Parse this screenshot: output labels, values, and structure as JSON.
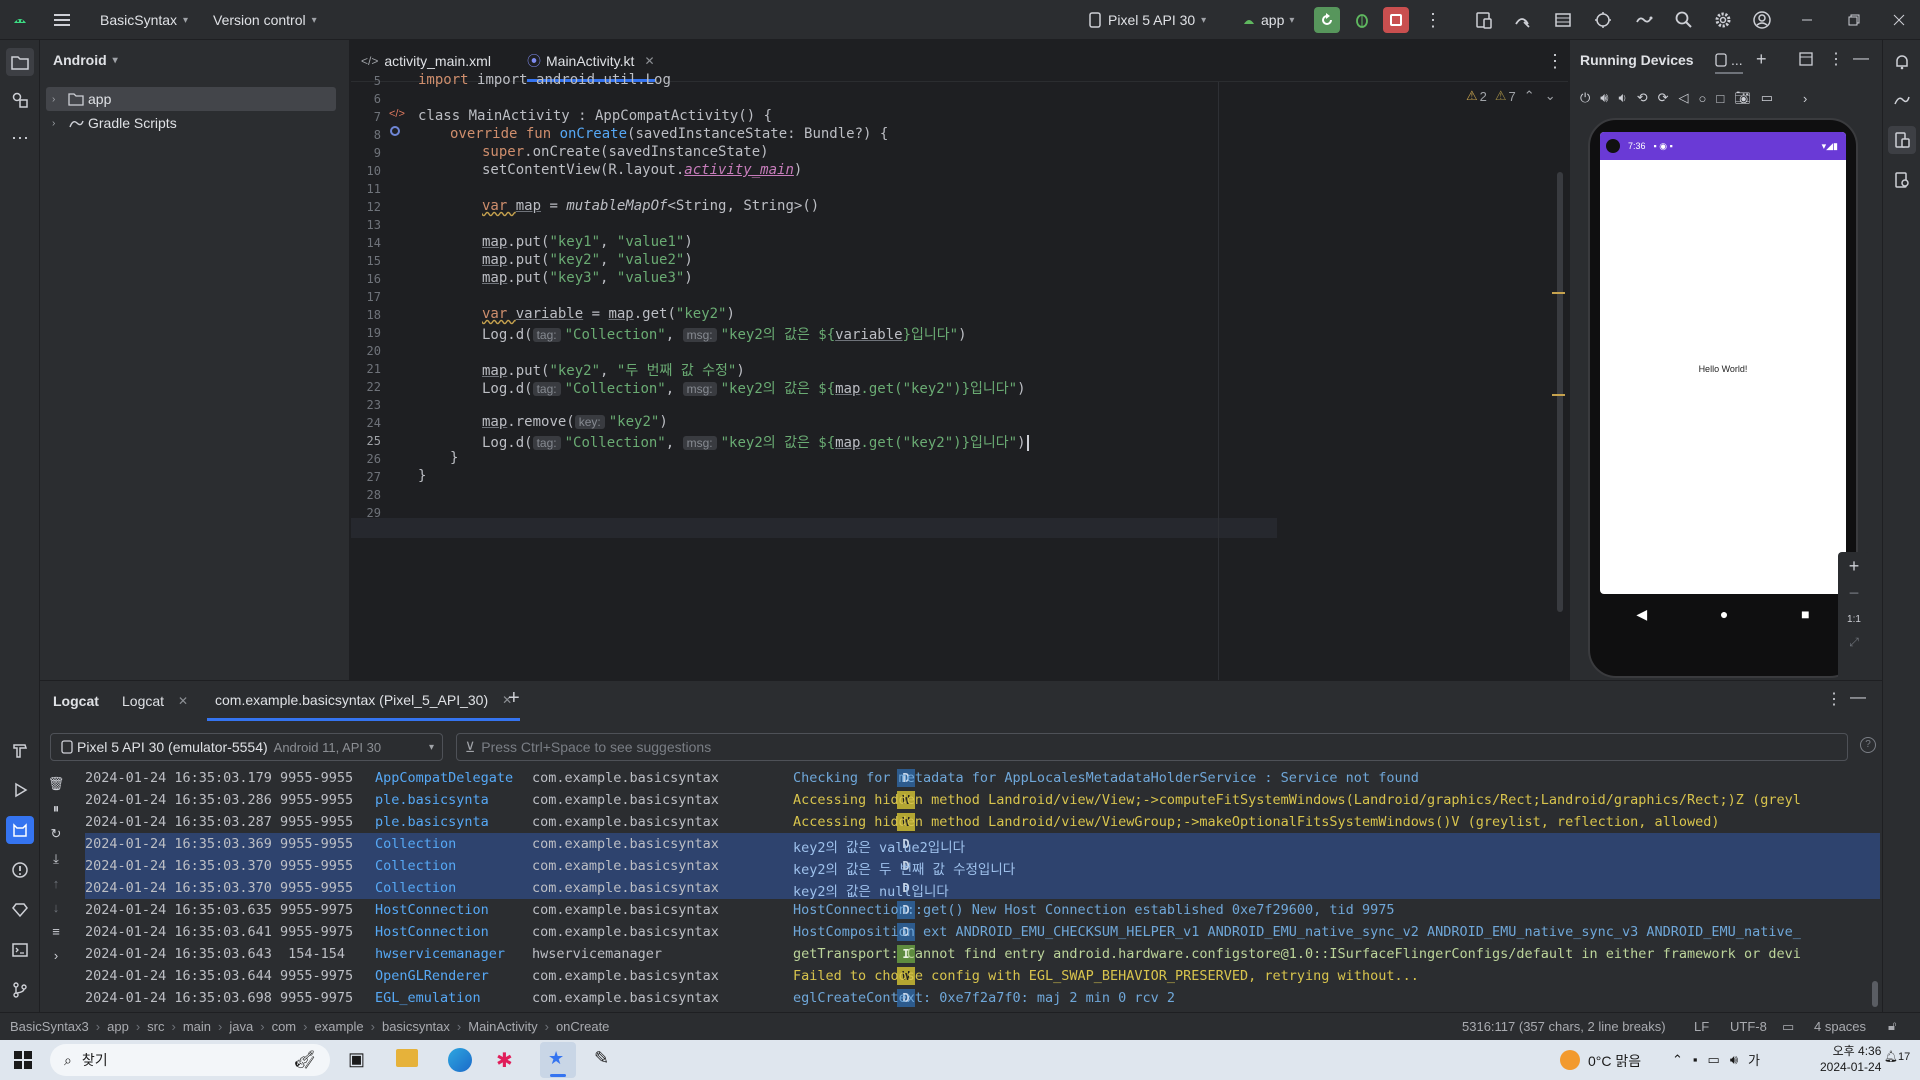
{
  "titlebar": {
    "project_name": "BasicSyntax",
    "vcs_label": "Version control",
    "device_selector": "Pixel 5 API 30",
    "run_config": "app"
  },
  "project_pane": {
    "view_name": "Android",
    "items": [
      {
        "label": "app"
      },
      {
        "label": "Gradle Scripts"
      }
    ]
  },
  "editor": {
    "tabs": [
      {
        "label": "activity_main.xml"
      },
      {
        "label": "MainActivity.kt"
      }
    ],
    "warnings_count": "2",
    "weak_warnings_count": "7",
    "line_numbers": [
      "5",
      "6",
      "7",
      "8",
      "9",
      "10",
      "11",
      "12",
      "13",
      "14",
      "15",
      "16",
      "17",
      "18",
      "19",
      "20",
      "21",
      "22",
      "23",
      "24",
      "25",
      "26",
      "27",
      "28",
      "29"
    ],
    "code": {
      "l5": "import android.util.Log",
      "l7_a": "class MainActivity : AppCompatActivity() {",
      "l8_a": "override fun ",
      "l8_b": "onCreate",
      "l8_c": "(savedInstanceState: Bundle?) {",
      "l9_a": "super",
      "l9_b": ".onCreate(savedInstanceState)",
      "l10_a": "setContentView(R.layout.",
      "l10_b": "activity_main",
      "l10_c": ")",
      "l12_a": "var ",
      "l12_b": "map",
      "l12_c": " = ",
      "l12_d": "mutableMapOf",
      "l12_e": "<String, String>()",
      "l14": [
        "map",
        ".put(",
        "\"key1\"",
        ", ",
        "\"value1\"",
        ")"
      ],
      "l15": [
        "map",
        ".put(",
        "\"key2\"",
        ", ",
        "\"value2\"",
        ")"
      ],
      "l16": [
        "map",
        ".put(",
        "\"key3\"",
        ", ",
        "\"value3\"",
        ")"
      ],
      "l18_a": "var ",
      "l18_b": "variable",
      "l18_c": " = ",
      "l18_d": "map",
      "l18_e": ".get(",
      "l18_f": "\"key2\"",
      "l18_g": ")",
      "hint_tag": "tag:",
      "hint_msg": "msg:",
      "hint_key": "key:",
      "log_d": "Log.d(",
      "collection": "\"Collection\"",
      "comma": ", ",
      "l19_msg_a": "\"key2의 값은 ${",
      "l19_msg_b": "variable",
      "l19_msg_c": "}입니다\"",
      "close": ")",
      "l21": [
        "map",
        ".put(",
        "\"key2\"",
        ", ",
        "\"두 번째 값 수정\"",
        ")"
      ],
      "l22_msg_a": "\"key2의 값은 ${",
      "l22_msg_b": "map",
      "l22_msg_c": ".get(\"key2\")}입니다\"",
      "l24_a": "map",
      "l24_b": ".remove(",
      "l24_c": "\"key2\"",
      "l24_d": ")",
      "l26": "}",
      "l27": "}"
    }
  },
  "devices": {
    "title": "Running Devices",
    "tab_label": "...",
    "phone_time": "7:36",
    "hello_text": "Hello World!",
    "zoom_label": "1:1"
  },
  "logcat": {
    "tabs": [
      {
        "label": "Logcat"
      },
      {
        "label": "Logcat"
      },
      {
        "label": "com.example.basicsyntax (Pixel_5_API_30)"
      }
    ],
    "device_dropdown": "Pixel 5 API 30 (emulator-5554)",
    "device_dropdown_sub": "Android 11, API 30",
    "filter_placeholder": "Press Ctrl+Space to see suggestions",
    "rows": [
      {
        "time": "2024-01-24 16:35:03.179",
        "pid": "9955-9955",
        "tag": "AppCompatDelegate",
        "pkg": "com.example.basicsyntax",
        "level": "D",
        "msg": "Checking for metadata for AppLocalesMetadataHolderService : Service not found",
        "selected": false
      },
      {
        "time": "2024-01-24 16:35:03.286",
        "pid": "9955-9955",
        "tag": "ple.basicsynta",
        "pkg": "com.example.basicsyntax",
        "level": "W",
        "msg": "Accessing hidden method Landroid/view/View;->computeFitSystemWindows(Landroid/graphics/Rect;Landroid/graphics/Rect;)Z (greyl",
        "selected": false
      },
      {
        "time": "2024-01-24 16:35:03.287",
        "pid": "9955-9955",
        "tag": "ple.basicsynta",
        "pkg": "com.example.basicsyntax",
        "level": "W",
        "msg": "Accessing hidden method Landroid/view/ViewGroup;->makeOptionalFitsSystemWindows()V (greylist, reflection, allowed)",
        "selected": false
      },
      {
        "time": "2024-01-24 16:35:03.369",
        "pid": "9955-9955",
        "tag": "Collection",
        "pkg": "com.example.basicsyntax",
        "level": "D",
        "msg": "key2의 값은 value2입니다",
        "selected": true
      },
      {
        "time": "2024-01-24 16:35:03.370",
        "pid": "9955-9955",
        "tag": "Collection",
        "pkg": "com.example.basicsyntax",
        "level": "D",
        "msg": "key2의 값은 두 번째 값 수정입니다",
        "selected": true
      },
      {
        "time": "2024-01-24 16:35:03.370",
        "pid": "9955-9955",
        "tag": "Collection",
        "pkg": "com.example.basicsyntax",
        "level": "D",
        "msg": "key2의 값은 null입니다",
        "selected": true
      },
      {
        "time": "2024-01-24 16:35:03.635",
        "pid": "9955-9975",
        "tag": "HostConnection",
        "pkg": "com.example.basicsyntax",
        "level": "D",
        "msg": "HostConnection::get() New Host Connection established 0xe7f29600, tid 9975",
        "selected": false
      },
      {
        "time": "2024-01-24 16:35:03.641",
        "pid": "9955-9975",
        "tag": "HostConnection",
        "pkg": "com.example.basicsyntax",
        "level": "D",
        "msg": "HostComposition ext ANDROID_EMU_CHECKSUM_HELPER_v1 ANDROID_EMU_native_sync_v2 ANDROID_EMU_native_sync_v3 ANDROID_EMU_native_",
        "selected": false
      },
      {
        "time": "2024-01-24 16:35:03.643",
        "pid": " 154-154 ",
        "tag": "hwservicemanager",
        "pkg": "hwservicemanager",
        "level": "I",
        "msg": "getTransport: Cannot find entry android.hardware.configstore@1.0::ISurfaceFlingerConfigs/default in either framework or devi",
        "selected": false
      },
      {
        "time": "2024-01-24 16:35:03.644",
        "pid": "9955-9975",
        "tag": "OpenGLRenderer",
        "pkg": "com.example.basicsyntax",
        "level": "W",
        "msg": "Failed to choose config with EGL_SWAP_BEHAVIOR_PRESERVED, retrying without...",
        "selected": false
      },
      {
        "time": "2024-01-24 16:35:03.698",
        "pid": "9955-9975",
        "tag": "EGL_emulation",
        "pkg": "com.example.basicsyntax",
        "level": "D",
        "msg": "eglCreateContext: 0xe7f2a7f0: maj 2 min 0 rcv 2",
        "selected": false
      }
    ]
  },
  "statusbar": {
    "breadcrumbs": [
      "BasicSyntax3",
      "app",
      "src",
      "main",
      "java",
      "com",
      "example",
      "basicsyntax",
      "MainActivity",
      "onCreate"
    ],
    "position": "5316:117 (357 chars, 2 line breaks)",
    "line_sep": "LF",
    "encoding": "UTF-8",
    "indent": "4 spaces"
  },
  "taskbar": {
    "search_label": "찾기",
    "weather": "0°C 맑음",
    "ime": "가",
    "time": "오후 4:36",
    "date": "2024-01-24",
    "notif_count": "17"
  },
  "colors": {
    "accent": "#3574f0",
    "selection": "#2e436e",
    "phone_status": "#6a3ad6"
  }
}
